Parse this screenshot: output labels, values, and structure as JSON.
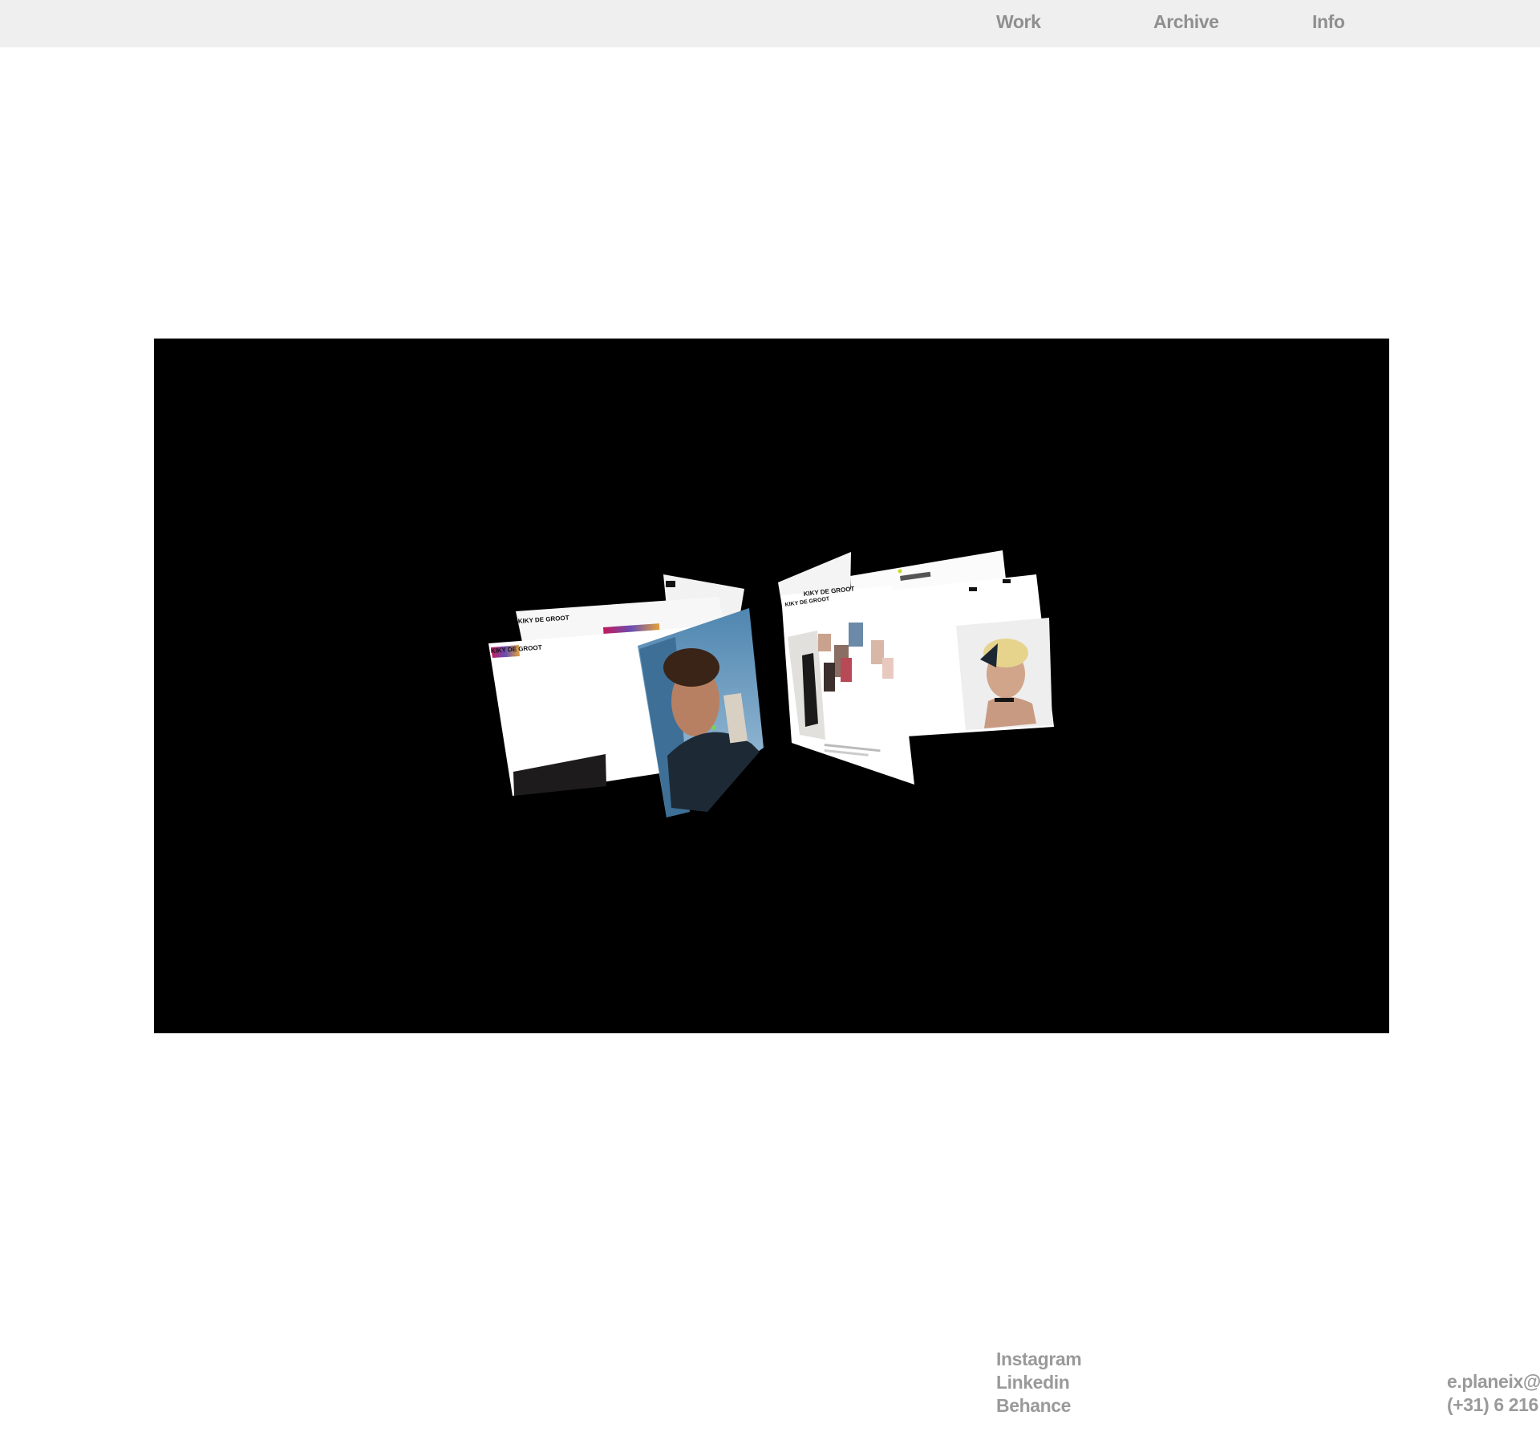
{
  "nav": {
    "work": "Work",
    "archive": "Archive",
    "info": "Info"
  },
  "hero": {
    "panel_text_a": "KIKY DE GROOT",
    "panel_text_b": "KIKY DE GROOT",
    "panel_text_c": "KIKY DE GROOT",
    "panel_text_d": "KIKY DE GROOT"
  },
  "footer": {
    "instagram": "Instagram",
    "linkedin": "Linkedin",
    "behance": "Behance",
    "email": "e.planeix@",
    "phone": "(+31) 6 216"
  },
  "colors": {
    "header_bg": "#efefef",
    "nav_text": "#8f8f8f",
    "footer_text": "#9a9a9a",
    "hero_bg": "#000000"
  }
}
